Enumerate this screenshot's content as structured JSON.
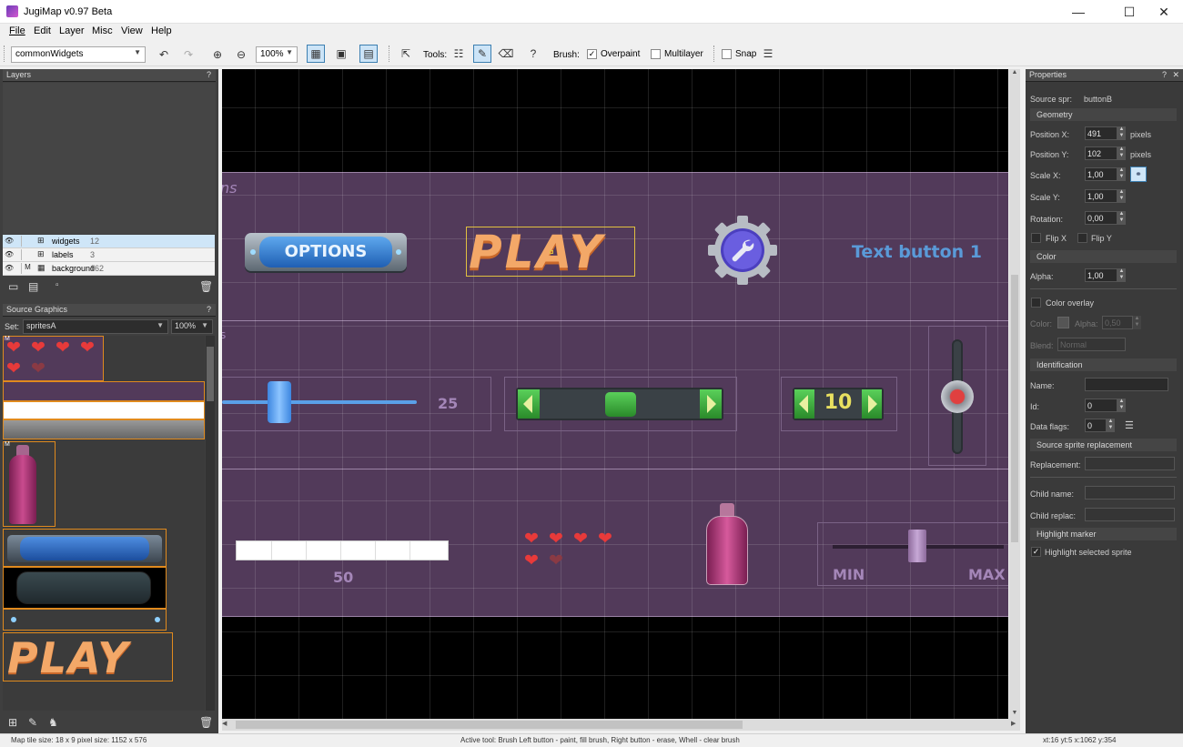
{
  "window": {
    "title": "JugiMap v0.97 Beta",
    "min": "—",
    "max": "☐",
    "close": "✕"
  },
  "menu": [
    "File",
    "Edit",
    "Layer",
    "Misc",
    "View",
    "Help"
  ],
  "toolbar": {
    "map_select": "commonWidgets",
    "zoom": "100%",
    "tools_label": "Tools:",
    "brush_label": "Brush:",
    "overpaint_label": "Overpaint",
    "overpaint_checked": true,
    "multilayer_label": "Multilayer",
    "multilayer_checked": false,
    "snap_label": "Snap",
    "snap_checked": false,
    "help_label": "?"
  },
  "layers_panel": {
    "title": "Layers",
    "help": "?",
    "layers": [
      {
        "name": "widgets",
        "count": "12",
        "selected": true
      },
      {
        "name": "labels",
        "count": "3",
        "selected": false
      },
      {
        "name": "background",
        "count": "162",
        "selected": false
      }
    ]
  },
  "source_panel": {
    "title": "Source Graphics",
    "help": "?",
    "set_label": "Set:",
    "set_value": "spritesA",
    "zoom": "100%",
    "thumb_play": "PLAY",
    "marker": "M"
  },
  "canvas": {
    "partial_text_1": "ns",
    "partial_text_2": "s",
    "options_label": "OPTIONS",
    "play_label": "PLAY",
    "text_button": "Text button 1",
    "slider_value": "25",
    "spinner_value": "10",
    "progress_value": "50",
    "progress_level": 0.5,
    "min_label": "MIN",
    "max_label": "MAX",
    "hearts_full": 5,
    "hearts_faded": 1
  },
  "properties": {
    "title": "Properties",
    "help": "?",
    "close": "✕",
    "source_spr_label": "Source spr:",
    "source_spr_value": "buttonB",
    "geometry": "Geometry",
    "pos_x_label": "Position X:",
    "pos_x": "491",
    "pos_y_label": "Position Y:",
    "pos_y": "102",
    "pixels": "pixels",
    "scale_x_label": "Scale X:",
    "scale_x": "1,00",
    "scale_y_label": "Scale Y:",
    "scale_y": "1,00",
    "rotation_label": "Rotation:",
    "rotation": "0,00",
    "flip_x": "Flip X",
    "flip_y": "Flip Y",
    "color": "Color",
    "alpha_label": "Alpha:",
    "alpha": "1,00",
    "color_overlay": "Color overlay",
    "color_label": "Color:",
    "alpha2_label": "Alpha:",
    "alpha2": "0,50",
    "blend_label": "Blend:",
    "blend": "Normal",
    "identification": "Identification",
    "name_label": "Name:",
    "name_value": "",
    "id_label": "Id:",
    "id_value": "0",
    "data_flags_label": "Data flags:",
    "data_flags": "0",
    "source_replacement": "Source sprite replacement",
    "replacement_label": "Replacement:",
    "child_name_label": "Child name:",
    "child_replac_label": "Child replac:",
    "highlight_marker": "Highlight marker",
    "highlight_selected": "Highlight selected sprite",
    "highlight_checked": true
  },
  "status": {
    "left": "Map tile size: 18 x 9   pixel size: 1152 x 576",
    "center": "Active tool: Brush  Left button - paint, fill brush,  Right button - erase, Whell - clear brush",
    "right": "xt:16  yt:5     x:1062  y:354"
  },
  "colors": {
    "band": "#523a5a",
    "band_border": "#9b83a6",
    "text_purple": "#a486b8",
    "text_blue": "#5a9ad8",
    "accent_orange": "#e08a1e",
    "green": "#2fa03a"
  }
}
